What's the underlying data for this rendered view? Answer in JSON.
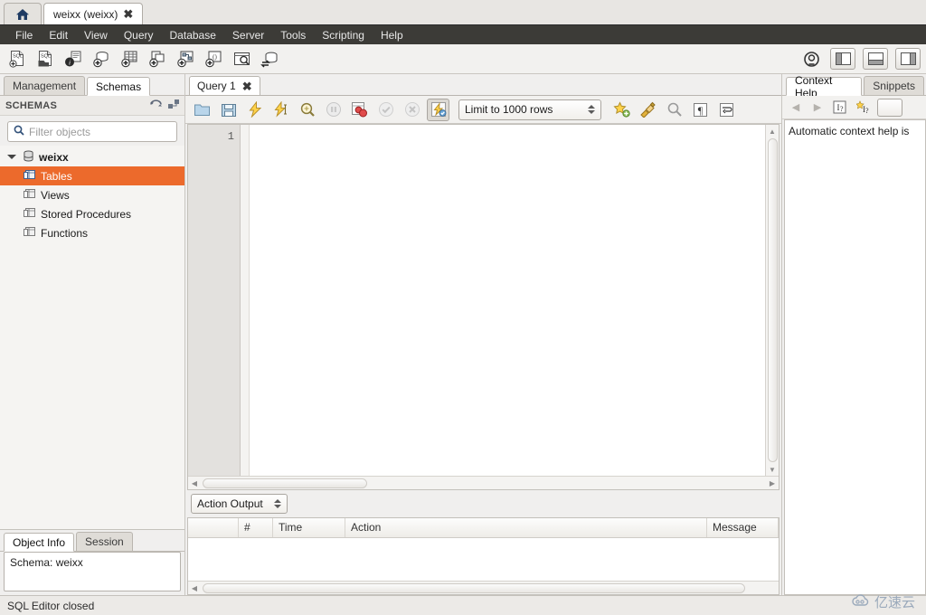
{
  "window": {
    "home_tab_icon": "home-icon",
    "connection_tab": "weixx (weixx)",
    "close_glyph": "✖"
  },
  "menu": {
    "items": [
      "File",
      "Edit",
      "View",
      "Query",
      "Database",
      "Server",
      "Tools",
      "Scripting",
      "Help"
    ]
  },
  "main_toolbar": {
    "buttons": [
      {
        "name": "new-sql-tab-icon",
        "label": "SQL"
      },
      {
        "name": "open-sql-script-icon",
        "label": "SQL"
      },
      {
        "name": "connection-info-icon",
        "label": "i"
      },
      {
        "name": "create-schema-icon",
        "label": "+"
      },
      {
        "name": "create-table-icon",
        "label": "+"
      },
      {
        "name": "create-view-icon",
        "label": "+"
      },
      {
        "name": "create-procedure-icon",
        "label": "+"
      },
      {
        "name": "create-function-icon",
        "label": "+"
      },
      {
        "name": "inspect-schema-icon",
        "label": "Q"
      },
      {
        "name": "reverse-engineer-icon",
        "label": "sync"
      }
    ],
    "right_buttons": [
      {
        "name": "scratch-icon"
      },
      {
        "name": "toggle-sidebar-icon"
      },
      {
        "name": "toggle-output-icon"
      },
      {
        "name": "toggle-secondary-sidebar-icon"
      }
    ]
  },
  "sidebar": {
    "tabs": [
      {
        "label": "Management",
        "active": false
      },
      {
        "label": "Schemas",
        "active": true
      }
    ],
    "section_title": "SCHEMAS",
    "filter": {
      "placeholder": "Filter objects",
      "value": ""
    },
    "tree": [
      {
        "label": "weixx",
        "level": 0,
        "type": "schema",
        "expanded": true,
        "selected": false
      },
      {
        "label": "Tables",
        "level": 1,
        "type": "folder",
        "selected": true
      },
      {
        "label": "Views",
        "level": 1,
        "type": "folder",
        "selected": false
      },
      {
        "label": "Stored Procedures",
        "level": 1,
        "type": "folder",
        "selected": false
      },
      {
        "label": "Functions",
        "level": 1,
        "type": "folder",
        "selected": false
      }
    ],
    "bottom_tabs": [
      {
        "label": "Object Info",
        "active": true
      },
      {
        "label": "Session",
        "active": false
      }
    ],
    "object_info_text": "Schema: weixx"
  },
  "editor": {
    "tabs": [
      {
        "label": "Query 1",
        "active": true
      }
    ],
    "toolbar": [
      {
        "name": "open-file-icon"
      },
      {
        "name": "save-file-icon"
      },
      {
        "name": "execute-statement-icon"
      },
      {
        "name": "execute-current-statement-icon"
      },
      {
        "name": "explain-statement-icon"
      },
      {
        "name": "stop-execution-icon"
      },
      {
        "name": "toggle-stop-on-error-icon"
      },
      {
        "name": "commit-icon"
      },
      {
        "name": "rollback-icon"
      },
      {
        "name": "toggle-autocommit-icon"
      }
    ],
    "limit_dropdown": {
      "value": "Limit to 1000 rows"
    },
    "right_toolbar": [
      {
        "name": "save-snippet-icon"
      },
      {
        "name": "beautify-query-icon"
      },
      {
        "name": "find-icon"
      },
      {
        "name": "toggle-invisible-chars-icon"
      },
      {
        "name": "toggle-wrapping-icon"
      }
    ],
    "line_numbers": [
      "1"
    ],
    "content": ""
  },
  "output": {
    "selector": {
      "value": "Action Output"
    },
    "columns": [
      "",
      "#",
      "Time",
      "Action",
      "Message"
    ],
    "rows": []
  },
  "context_help": {
    "tabs": [
      {
        "label": "Context Help",
        "active": true
      },
      {
        "label": "Snippets",
        "active": false
      }
    ],
    "toolbar": [
      {
        "name": "back-arrow-icon"
      },
      {
        "name": "forward-arrow-icon"
      },
      {
        "name": "manual-help-icon"
      },
      {
        "name": "auto-help-icon"
      }
    ],
    "body_text": "Automatic context help is"
  },
  "statusbar": {
    "text": "SQL Editor closed"
  },
  "watermark": {
    "text": "亿速云"
  },
  "colors": {
    "selection": "#ec6a2c",
    "menubar_bg": "#3c3b37",
    "toolbar_bg": "#f2f1ef",
    "panel_bg": "#f0efee"
  }
}
